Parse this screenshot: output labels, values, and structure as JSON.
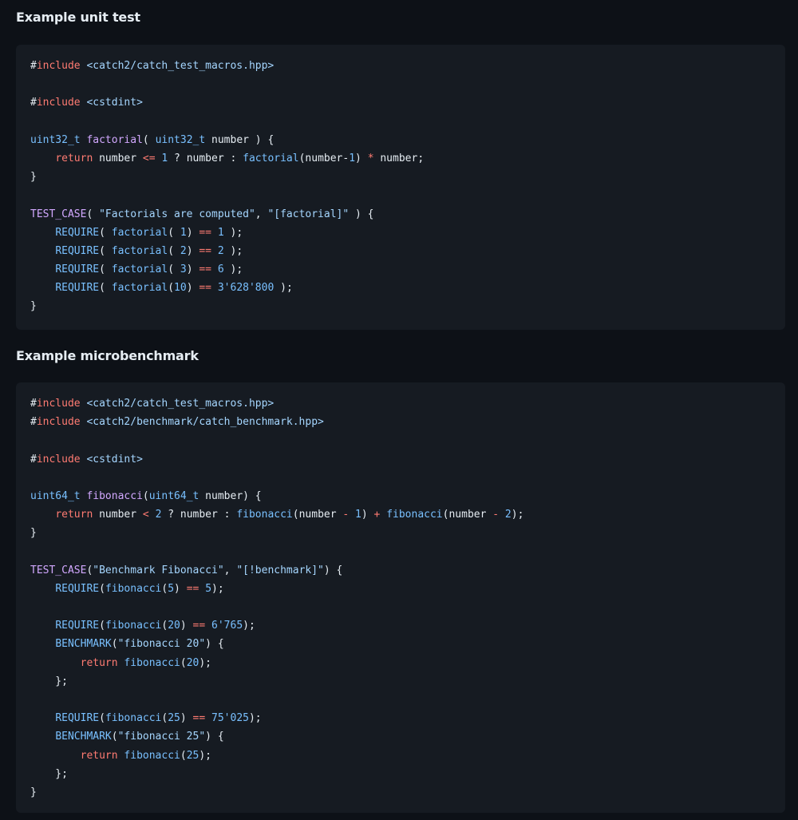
{
  "sections": [
    {
      "heading": "Example unit test",
      "lines": [
        [
          [
            "#",
            "hash"
          ],
          [
            "include",
            "pre"
          ],
          [
            " <catch2/catch_test_macros.hpp>",
            "str"
          ]
        ],
        [],
        [
          [
            "#",
            "hash"
          ],
          [
            "include",
            "pre"
          ],
          [
            " <cstdint>",
            "str"
          ]
        ],
        [],
        [
          [
            "uint32_t",
            "type"
          ],
          [
            " ",
            "plain"
          ],
          [
            "factorial",
            "fn"
          ],
          [
            "( ",
            "plain"
          ],
          [
            "uint32_t",
            "type"
          ],
          [
            " number ) {",
            "plain"
          ]
        ],
        [
          [
            "    ",
            "plain"
          ],
          [
            "return",
            "kw"
          ],
          [
            " number ",
            "plain"
          ],
          [
            "<=",
            "op"
          ],
          [
            " ",
            "plain"
          ],
          [
            "1",
            "num"
          ],
          [
            " ? number : ",
            "plain"
          ],
          [
            "factorial",
            "type"
          ],
          [
            "(number-",
            "plain"
          ],
          [
            "1",
            "num"
          ],
          [
            ") ",
            "plain"
          ],
          [
            "*",
            "op"
          ],
          [
            " number;",
            "plain"
          ]
        ],
        [
          [
            "}",
            "plain"
          ]
        ],
        [],
        [
          [
            "TEST_CASE",
            "mac2"
          ],
          [
            "( ",
            "plain"
          ],
          [
            "\"Factorials are computed\"",
            "str"
          ],
          [
            ", ",
            "plain"
          ],
          [
            "\"[factorial]\"",
            "str"
          ],
          [
            " ) {",
            "plain"
          ]
        ],
        [
          [
            "    ",
            "plain"
          ],
          [
            "REQUIRE",
            "mac"
          ],
          [
            "( ",
            "plain"
          ],
          [
            "factorial",
            "type"
          ],
          [
            "( ",
            "plain"
          ],
          [
            "1",
            "num"
          ],
          [
            ") ",
            "plain"
          ],
          [
            "==",
            "op"
          ],
          [
            " ",
            "plain"
          ],
          [
            "1",
            "num"
          ],
          [
            " );",
            "plain"
          ]
        ],
        [
          [
            "    ",
            "plain"
          ],
          [
            "REQUIRE",
            "mac"
          ],
          [
            "( ",
            "plain"
          ],
          [
            "factorial",
            "type"
          ],
          [
            "( ",
            "plain"
          ],
          [
            "2",
            "num"
          ],
          [
            ") ",
            "plain"
          ],
          [
            "==",
            "op"
          ],
          [
            " ",
            "plain"
          ],
          [
            "2",
            "num"
          ],
          [
            " );",
            "plain"
          ]
        ],
        [
          [
            "    ",
            "plain"
          ],
          [
            "REQUIRE",
            "mac"
          ],
          [
            "( ",
            "plain"
          ],
          [
            "factorial",
            "type"
          ],
          [
            "( ",
            "plain"
          ],
          [
            "3",
            "num"
          ],
          [
            ") ",
            "plain"
          ],
          [
            "==",
            "op"
          ],
          [
            " ",
            "plain"
          ],
          [
            "6",
            "num"
          ],
          [
            " );",
            "plain"
          ]
        ],
        [
          [
            "    ",
            "plain"
          ],
          [
            "REQUIRE",
            "mac"
          ],
          [
            "( ",
            "plain"
          ],
          [
            "factorial",
            "type"
          ],
          [
            "(",
            "plain"
          ],
          [
            "10",
            "num"
          ],
          [
            ") ",
            "plain"
          ],
          [
            "==",
            "op"
          ],
          [
            " ",
            "plain"
          ],
          [
            "3'628'800",
            "num"
          ],
          [
            " );",
            "plain"
          ]
        ],
        [
          [
            "}",
            "plain"
          ]
        ]
      ]
    },
    {
      "heading": "Example microbenchmark",
      "lines": [
        [
          [
            "#",
            "hash"
          ],
          [
            "include",
            "pre"
          ],
          [
            " <catch2/catch_test_macros.hpp>",
            "str"
          ]
        ],
        [
          [
            "#",
            "hash"
          ],
          [
            "include",
            "pre"
          ],
          [
            " <catch2/benchmark/catch_benchmark.hpp>",
            "str"
          ]
        ],
        [],
        [
          [
            "#",
            "hash"
          ],
          [
            "include",
            "pre"
          ],
          [
            " <cstdint>",
            "str"
          ]
        ],
        [],
        [
          [
            "uint64_t",
            "type"
          ],
          [
            " ",
            "plain"
          ],
          [
            "fibonacci",
            "fn"
          ],
          [
            "(",
            "plain"
          ],
          [
            "uint64_t",
            "type"
          ],
          [
            " number) {",
            "plain"
          ]
        ],
        [
          [
            "    ",
            "plain"
          ],
          [
            "return",
            "kw"
          ],
          [
            " number ",
            "plain"
          ],
          [
            "<",
            "op"
          ],
          [
            " ",
            "plain"
          ],
          [
            "2",
            "num"
          ],
          [
            " ? number : ",
            "plain"
          ],
          [
            "fibonacci",
            "type"
          ],
          [
            "(number ",
            "plain"
          ],
          [
            "-",
            "op"
          ],
          [
            " ",
            "plain"
          ],
          [
            "1",
            "num"
          ],
          [
            ") ",
            "plain"
          ],
          [
            "+",
            "op"
          ],
          [
            " ",
            "plain"
          ],
          [
            "fibonacci",
            "type"
          ],
          [
            "(number ",
            "plain"
          ],
          [
            "-",
            "op"
          ],
          [
            " ",
            "plain"
          ],
          [
            "2",
            "num"
          ],
          [
            ");",
            "plain"
          ]
        ],
        [
          [
            "}",
            "plain"
          ]
        ],
        [],
        [
          [
            "TEST_CASE",
            "mac2"
          ],
          [
            "(",
            "plain"
          ],
          [
            "\"Benchmark Fibonacci\"",
            "str"
          ],
          [
            ", ",
            "plain"
          ],
          [
            "\"[!benchmark]\"",
            "str"
          ],
          [
            ") {",
            "plain"
          ]
        ],
        [
          [
            "    ",
            "plain"
          ],
          [
            "REQUIRE",
            "mac"
          ],
          [
            "(",
            "plain"
          ],
          [
            "fibonacci",
            "type"
          ],
          [
            "(",
            "plain"
          ],
          [
            "5",
            "num"
          ],
          [
            ") ",
            "plain"
          ],
          [
            "==",
            "op"
          ],
          [
            " ",
            "plain"
          ],
          [
            "5",
            "num"
          ],
          [
            ");",
            "plain"
          ]
        ],
        [],
        [
          [
            "    ",
            "plain"
          ],
          [
            "REQUIRE",
            "mac"
          ],
          [
            "(",
            "plain"
          ],
          [
            "fibonacci",
            "type"
          ],
          [
            "(",
            "plain"
          ],
          [
            "20",
            "num"
          ],
          [
            ") ",
            "plain"
          ],
          [
            "==",
            "op"
          ],
          [
            " ",
            "plain"
          ],
          [
            "6'765",
            "num"
          ],
          [
            ");",
            "plain"
          ]
        ],
        [
          [
            "    ",
            "plain"
          ],
          [
            "BENCHMARK",
            "mac"
          ],
          [
            "(",
            "plain"
          ],
          [
            "\"fibonacci 20\"",
            "str"
          ],
          [
            ") {",
            "plain"
          ]
        ],
        [
          [
            "        ",
            "plain"
          ],
          [
            "return",
            "kw"
          ],
          [
            " ",
            "plain"
          ],
          [
            "fibonacci",
            "type"
          ],
          [
            "(",
            "plain"
          ],
          [
            "20",
            "num"
          ],
          [
            ");",
            "plain"
          ]
        ],
        [
          [
            "    };",
            "plain"
          ]
        ],
        [],
        [
          [
            "    ",
            "plain"
          ],
          [
            "REQUIRE",
            "mac"
          ],
          [
            "(",
            "plain"
          ],
          [
            "fibonacci",
            "type"
          ],
          [
            "(",
            "plain"
          ],
          [
            "25",
            "num"
          ],
          [
            ") ",
            "plain"
          ],
          [
            "==",
            "op"
          ],
          [
            " ",
            "plain"
          ],
          [
            "75'025",
            "num"
          ],
          [
            ");",
            "plain"
          ]
        ],
        [
          [
            "    ",
            "plain"
          ],
          [
            "BENCHMARK",
            "mac"
          ],
          [
            "(",
            "plain"
          ],
          [
            "\"fibonacci 25\"",
            "str"
          ],
          [
            ") {",
            "plain"
          ]
        ],
        [
          [
            "        ",
            "plain"
          ],
          [
            "return",
            "kw"
          ],
          [
            " ",
            "plain"
          ],
          [
            "fibonacci",
            "type"
          ],
          [
            "(",
            "plain"
          ],
          [
            "25",
            "num"
          ],
          [
            ");",
            "plain"
          ]
        ],
        [
          [
            "    };",
            "plain"
          ]
        ],
        [
          [
            "}",
            "plain"
          ]
        ]
      ]
    }
  ],
  "colors": {
    "background": "#0d1117",
    "code_background": "#161b22",
    "text": "#e6edf3",
    "keyword": "#ff7b72",
    "string": "#a5d6ff",
    "type": "#79c0ff",
    "function": "#d2a8ff"
  }
}
